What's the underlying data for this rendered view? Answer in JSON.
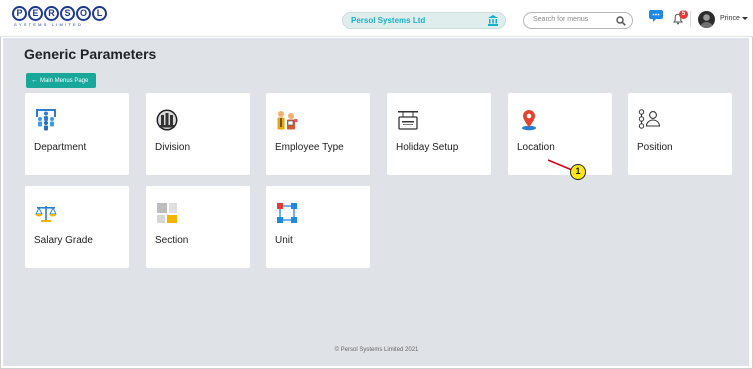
{
  "header": {
    "logo_text": "PERSOL",
    "logo_subtext": "SYSTEMS LIMITED",
    "company_name": "Persol Systems Ltd",
    "company_icon": "bank-icon",
    "search_placeholder": "Search for menus",
    "notification_count": "5",
    "username": "Prince"
  },
  "page": {
    "title": "Generic Parameters",
    "back_button": "Main Menus Page"
  },
  "cards": [
    {
      "label": "Department",
      "icon": "department-icon"
    },
    {
      "label": "Division",
      "icon": "division-icon"
    },
    {
      "label": "Employee Type",
      "icon": "employee-type-icon"
    },
    {
      "label": "Holiday Setup",
      "icon": "holiday-sign-icon"
    },
    {
      "label": "Location",
      "icon": "location-pin-icon"
    },
    {
      "label": "Position",
      "icon": "position-icon"
    },
    {
      "label": "Salary Grade",
      "icon": "scales-icon"
    },
    {
      "label": "Section",
      "icon": "section-icon"
    },
    {
      "label": "Unit",
      "icon": "unit-icon"
    }
  ],
  "footer": "© Persol Systems Limited 2021",
  "annotation": {
    "label": "1"
  },
  "colors": {
    "accent": "#17a89b",
    "brand": "#1b3a8f",
    "background": "#dfe2e7",
    "badge": "#e53935",
    "callout": "#ffe816"
  }
}
